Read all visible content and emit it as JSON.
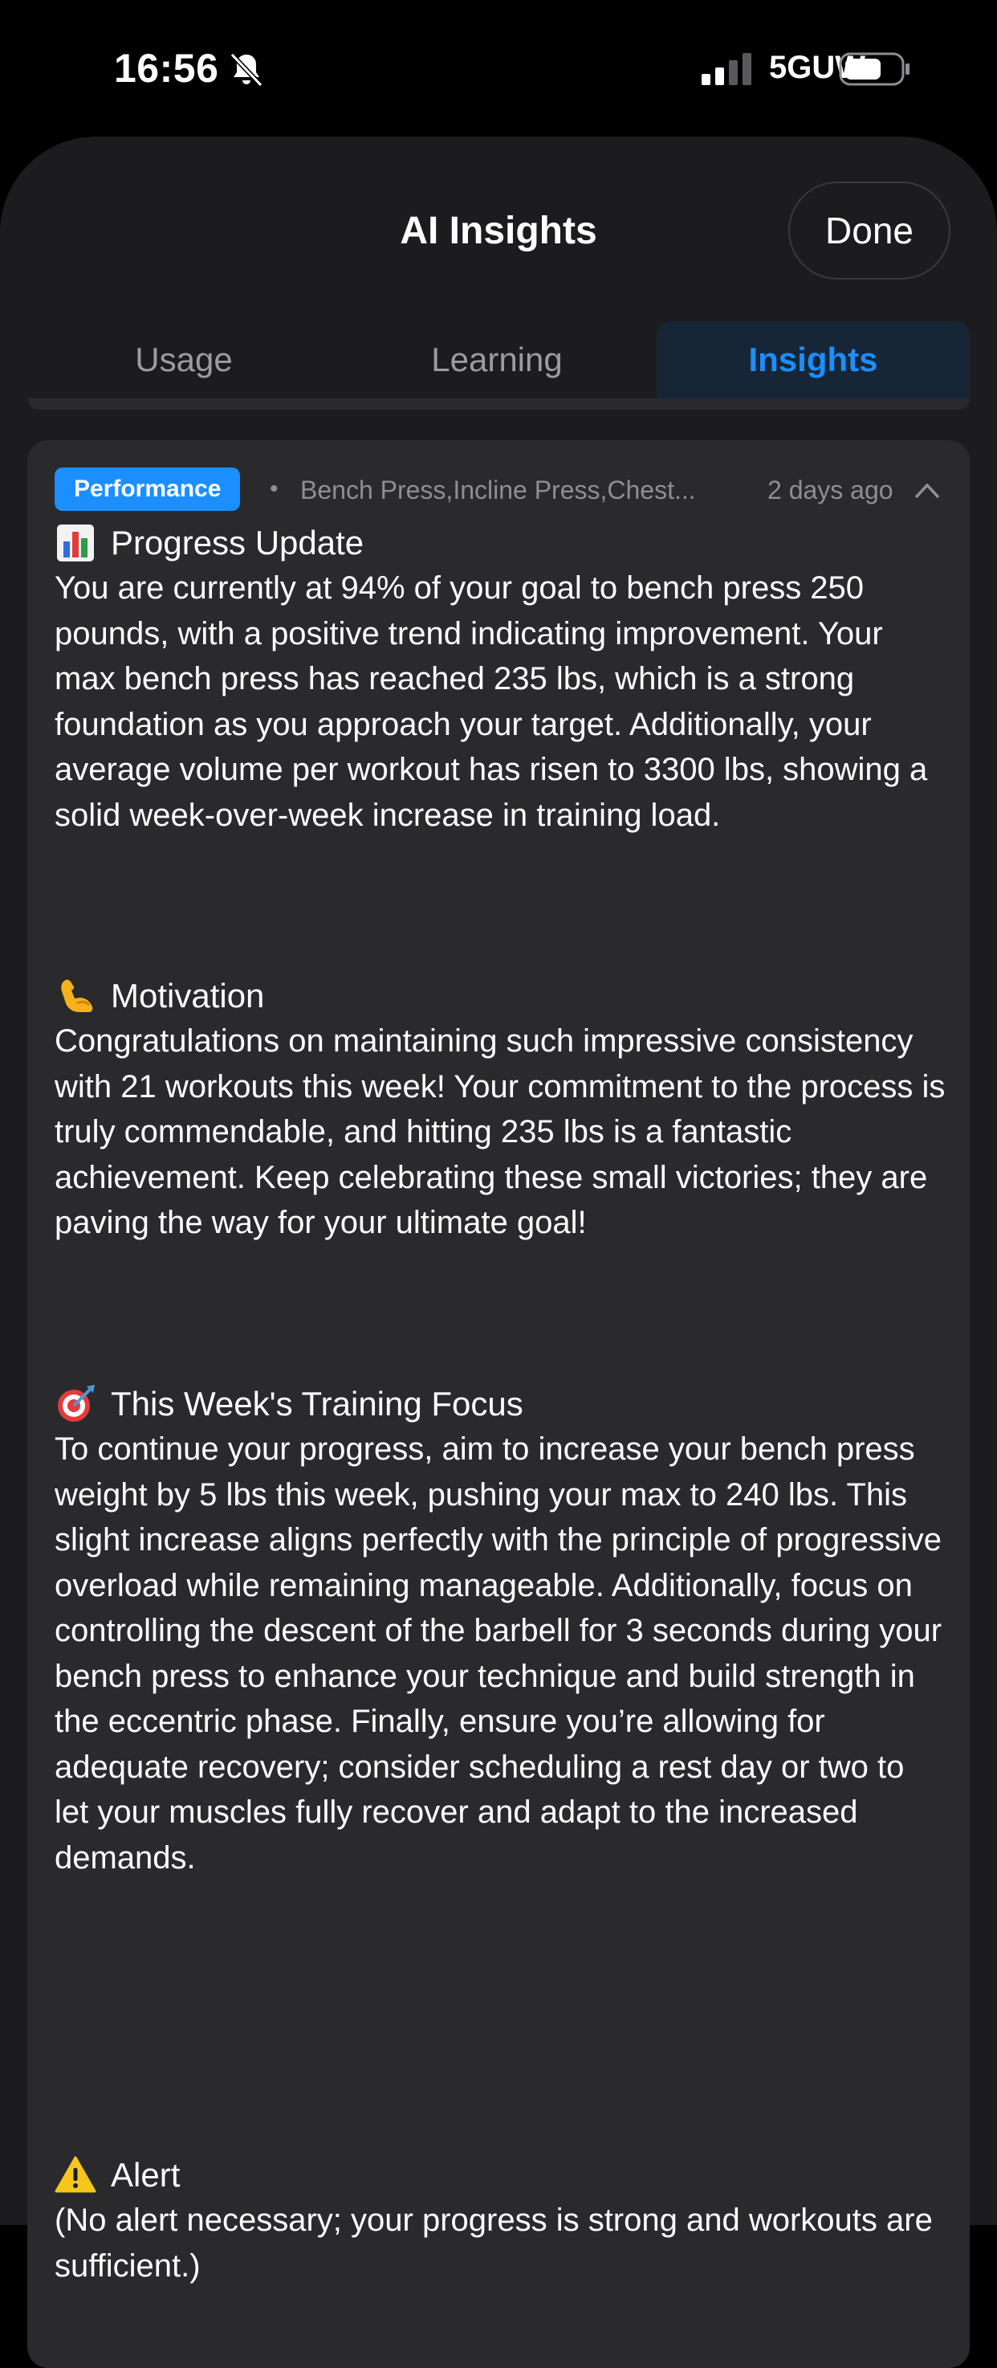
{
  "status_bar": {
    "time": "16:56",
    "network": "5GUW",
    "icons": [
      "bell-slash-icon",
      "signal-icon",
      "battery-icon"
    ]
  },
  "sheet": {
    "title": "AI Insights",
    "done_label": "Done"
  },
  "tabs": [
    {
      "label": "Usage",
      "selected": false
    },
    {
      "label": "Learning",
      "selected": false
    },
    {
      "label": "Insights",
      "selected": true
    }
  ],
  "insight_card": {
    "category": "Performance",
    "exercises": "Bench Press,Incline Press,Chest...",
    "time_ago": "2 days ago",
    "sections": [
      {
        "icon": "bar-chart-icon",
        "title": "Progress Update",
        "body": "You are currently at 94% of your goal to bench press 250 pounds, with a positive trend indicating improvement. Your max bench press has reached 235 lbs, which is a strong foundation as you approach your target. Additionally, your average volume per workout has risen to 3300 lbs, showing a solid week-over-week increase in training load."
      },
      {
        "icon": "flexed-bicep-icon",
        "title": "Motivation",
        "body": "Congratulations on maintaining such impressive consistency with 21 workouts this week! Your commitment to the process is truly commendable, and hitting 235 lbs is a fantastic achievement. Keep celebrating these small victories; they are paving the way for your ultimate goal!"
      },
      {
        "icon": "target-icon",
        "title": "This Week's Training Focus",
        "body": "To continue your progress, aim to increase your bench press weight by 5 lbs this week, pushing your max to 240 lbs. This slight increase aligns perfectly with the principle of progressive overload while remaining manageable. Additionally, focus on controlling the descent of the barbell for 3 seconds during your bench press to enhance your technique and build strength in the eccentric phase. Finally, ensure you’re allowing for adequate recovery; consider scheduling a rest day or two to let your muscles fully recover and adapt to the increased demands."
      },
      {
        "icon": "warning-icon",
        "title": "Alert",
        "body": "(No alert necessary; your progress is strong and workouts are sufficient.)"
      }
    ]
  },
  "colors": {
    "accent": "#1b8fff",
    "sheet_bg": "#1c1c1e",
    "card_bg": "#2a2a2d",
    "muted_text": "#8e8e93"
  }
}
